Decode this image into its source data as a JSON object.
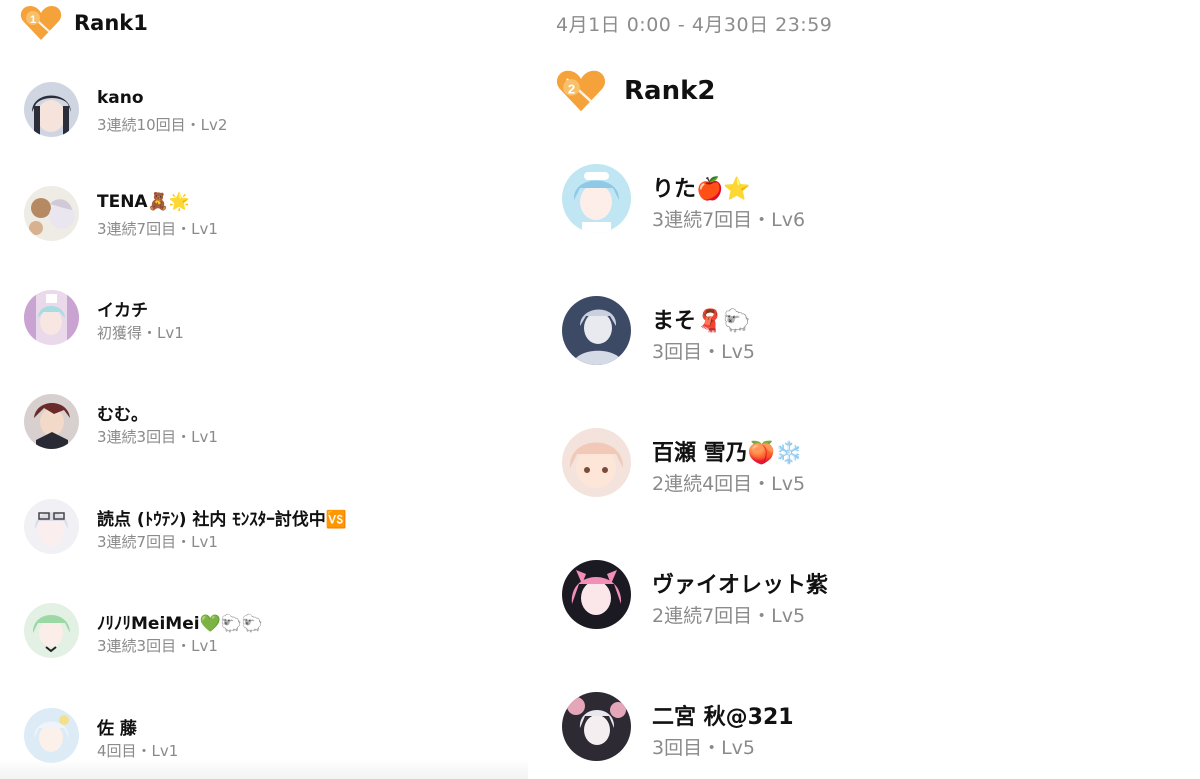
{
  "left": {
    "rank_label": "Rank1",
    "rank_number": "1",
    "users": [
      {
        "name": "kano",
        "meta": "3連続10回目・Lv2"
      },
      {
        "name": "TENA🧸🌟",
        "meta": "3連続7回目・Lv1"
      },
      {
        "name": "イカチ",
        "meta": "初獲得・Lv1"
      },
      {
        "name": "むむ。",
        "meta": "3連続3回目・Lv1"
      },
      {
        "name": "読点 (ﾄｳﾃﾝ) 社内 ﾓﾝｽﾀｰ討伐中🆚",
        "meta": "3連続7回目・Lv1"
      },
      {
        "name": "ﾉﾘﾉﾘMeiMei💚🐑🐑",
        "meta": "3連続3回目・Lv1"
      },
      {
        "name": "佐 藤",
        "meta": "4回目・Lv1"
      }
    ]
  },
  "right": {
    "date_range": "4月1日 0:00 - 4月30日 23:59",
    "rank_label": "Rank2",
    "rank_number": "2",
    "users": [
      {
        "name": "りた🍎⭐",
        "meta": "3連続7回目・Lv6"
      },
      {
        "name": "まそ🧣🐑",
        "meta": "3回目・Lv5"
      },
      {
        "name": "百瀬 雪乃🍑❄️",
        "meta": "2連続4回目・Lv5"
      },
      {
        "name": "ヴァイオレット紫",
        "meta": "2連続7回目・Lv5"
      },
      {
        "name": "二宮 秋@321",
        "meta": "3回目・Lv5"
      }
    ]
  },
  "colors": {
    "badge_orange": "#f5a23b",
    "badge_orange_light": "#f8c06a",
    "meta_gray": "#8a8a8a"
  }
}
